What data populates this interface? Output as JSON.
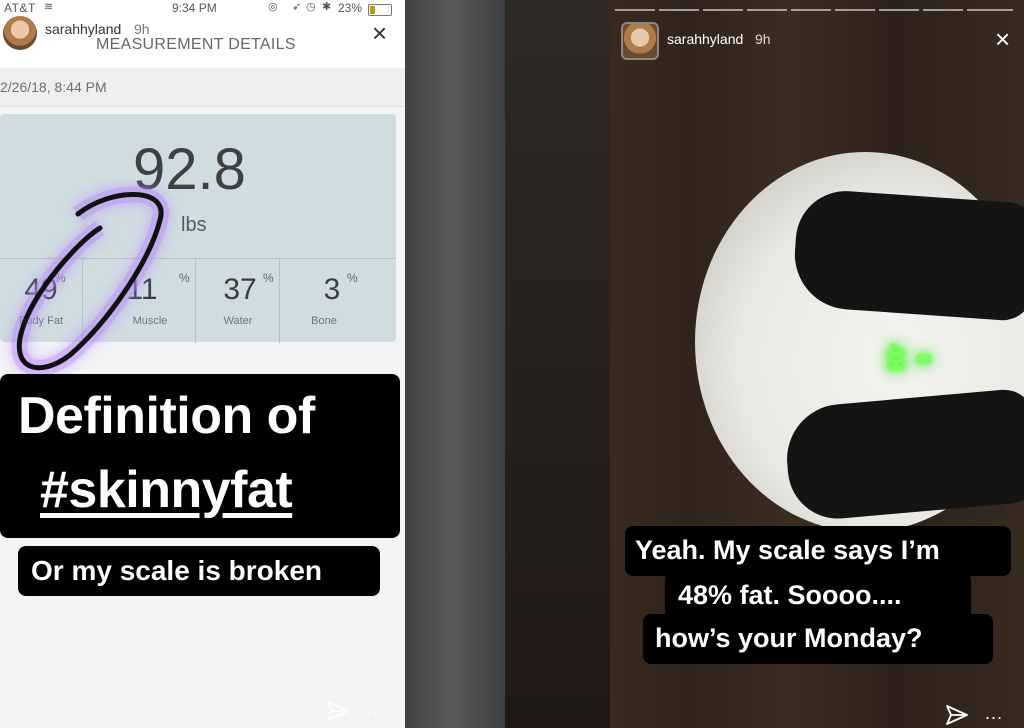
{
  "left_story": {
    "status_bar": {
      "carrier": "AT&T",
      "time": "9:34 PM",
      "battery": "23%"
    },
    "header": {
      "username": "sarahhyland",
      "time_ago": "9h",
      "close": "×"
    },
    "app": {
      "title": "MEASUREMENT DETAILS",
      "date": "2/26/18, 8:44 PM",
      "weight": "92.8",
      "weight_unit": "lbs",
      "stats": [
        {
          "value": "49",
          "unit": "%",
          "label": "Body Fat"
        },
        {
          "value": "11",
          "unit": "%",
          "label": "Muscle"
        },
        {
          "value": "37",
          "unit": "%",
          "label": "Water"
        },
        {
          "value": "3",
          "unit": "%",
          "label": "Bone"
        }
      ]
    },
    "caption": {
      "line1": "Definition of",
      "line2": "#skinnyfat",
      "line3": "Or my scale is broken"
    },
    "footer": {
      "more": "..."
    }
  },
  "right_story": {
    "header": {
      "username": "sarahhyland",
      "time_ago": "9h",
      "close": "×"
    },
    "scale_display": {
      "digits_a": "48",
      "digits_b": "8"
    },
    "caption": {
      "line1": "Yeah. My scale says I’m",
      "line2": "48% fat. Soooo....",
      "line3": "how’s your Monday?"
    },
    "footer": {
      "more": "..."
    }
  },
  "colors": {
    "caption_bg": "#000000",
    "caption_text": "#ffffff",
    "scribble": "#a066ff",
    "scale_led": "#7dff5a",
    "card_bg": "#cfdde0"
  },
  "icons": [
    "close-icon",
    "send-icon",
    "more-icon",
    "wifi-icon",
    "battery-icon",
    "alarm-icon",
    "bluetooth-icon",
    "location-icon"
  ]
}
